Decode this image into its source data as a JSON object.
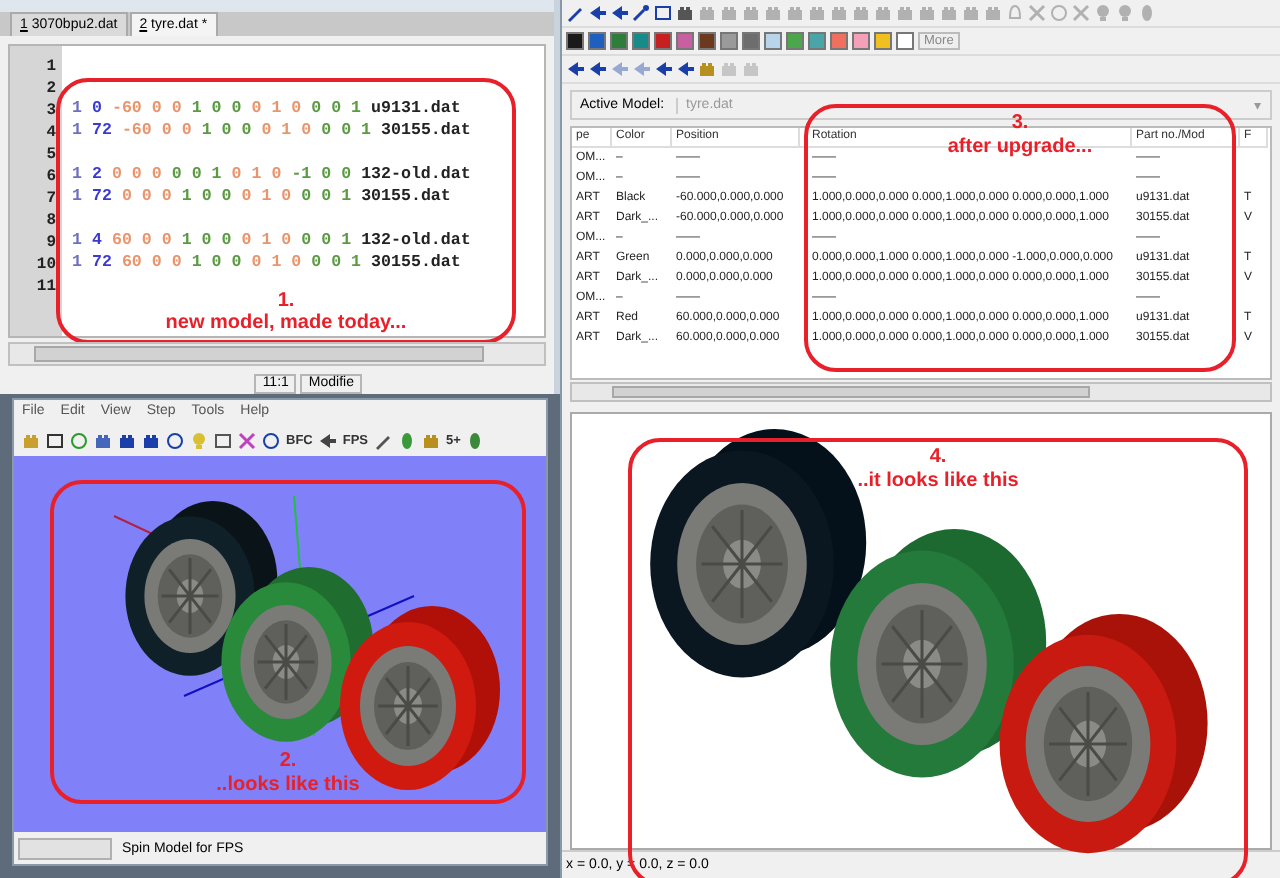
{
  "editor": {
    "tabs": [
      {
        "key": "1",
        "name": "3070bpu2.dat",
        "selected": false
      },
      {
        "key": "2",
        "name": "tyre.dat *",
        "selected": true
      }
    ],
    "lines": [
      {
        "number": "1",
        "kind": "blank"
      },
      {
        "number": "2",
        "kind": "blank"
      },
      {
        "number": "3",
        "kind": "part",
        "type": "1",
        "color_code": "0",
        "position": "-60 0 0",
        "rotation": [
          "1 0 0",
          "0 1 0",
          "0 0 1"
        ],
        "file": "u9131.dat"
      },
      {
        "number": "4",
        "kind": "part",
        "type": "1",
        "color_code": "72",
        "position": "-60 0 0",
        "rotation": [
          "1 0 0",
          "0 1 0",
          "0 0 1"
        ],
        "file": "30155.dat"
      },
      {
        "number": "5",
        "kind": "blank"
      },
      {
        "number": "6",
        "kind": "part",
        "type": "1",
        "color_code": "2",
        "position": "0 0 0",
        "rotation": [
          "0 0 1",
          "0 1 0",
          "-1 0 0"
        ],
        "file": "132-old.dat"
      },
      {
        "number": "7",
        "kind": "part",
        "type": "1",
        "color_code": "72",
        "position": "0 0 0",
        "rotation": [
          "1 0 0",
          "0 1 0",
          "0 0 1"
        ],
        "file": "30155.dat"
      },
      {
        "number": "8",
        "kind": "blank"
      },
      {
        "number": "9",
        "kind": "part",
        "type": "1",
        "color_code": "4",
        "position": "60 0 0",
        "rotation": [
          "1 0 0",
          "0 1 0",
          "0 0 1"
        ],
        "file": "132-old.dat"
      },
      {
        "number": "10",
        "kind": "part",
        "type": "1",
        "color_code": "72",
        "position": "60 0 0",
        "rotation": [
          "1 0 0",
          "0 1 0",
          "0 0 1"
        ],
        "file": "30155.dat"
      },
      {
        "number": "11",
        "kind": "blank"
      }
    ],
    "annotation": {
      "number": "1.",
      "text": "new model, made today..."
    },
    "status": {
      "position": "11:1",
      "state": "Modifie"
    }
  },
  "viewer": {
    "menu": [
      "File",
      "Edit",
      "View",
      "Step",
      "Tools",
      "Help"
    ],
    "toolbar_texts": [
      "BFC",
      "FPS",
      "5+"
    ],
    "annotation": {
      "number": "2.",
      "text": "..looks like this"
    },
    "status": {
      "progress": {
        "level": 0
      },
      "message": "Spin Model for FPS"
    }
  },
  "modeler": {
    "swatches": [
      {
        "color": "#1a1a1a"
      },
      {
        "color": "#1e5fc0"
      },
      {
        "color": "#2e7d3a"
      },
      {
        "color": "#178a8a"
      },
      {
        "color": "#c82020"
      },
      {
        "color": "#c85fa0"
      },
      {
        "color": "#6b3a1e"
      },
      {
        "color": "#9a9a9a"
      },
      {
        "color": "#6d6d6d"
      },
      {
        "color": "#b8d4ea"
      },
      {
        "color": "#4ca64c"
      },
      {
        "color": "#4aa5a8"
      },
      {
        "color": "#f07060"
      },
      {
        "color": "#f4a0b8"
      },
      {
        "color": "#f0c020"
      },
      {
        "color": "#ffffff"
      }
    ],
    "more_button": "More",
    "active_model": {
      "label": "Active Model:",
      "value": "tyre.dat",
      "caret": "▾"
    },
    "table": {
      "columns": [
        "pe",
        "Color",
        "Position",
        "Rotation",
        "Part no./Mod",
        "F"
      ],
      "rows": [
        [
          "OM...",
          "–",
          "——",
          "——",
          "——"
        ],
        [
          "OM...",
          "–",
          "——",
          "——",
          "——"
        ],
        [
          "ART",
          "Black",
          "-60.000,0.000,0.000",
          "1.000,0.000,0.000 0.000,1.000,0.000 0.000,0.000,1.000",
          "u9131.dat",
          "T"
        ],
        [
          "ART",
          "Dark_...",
          "-60.000,0.000,0.000",
          "1.000,0.000,0.000 0.000,1.000,0.000 0.000,0.000,1.000",
          "30155.dat",
          "V"
        ],
        [
          "OM...",
          "–",
          "——",
          "——",
          "——"
        ],
        [
          "ART",
          "Green",
          "0.000,0.000,0.000",
          "0.000,0.000,1.000 0.000,1.000,0.000 -1.000,0.000,0.000",
          "u9131.dat",
          "T"
        ],
        [
          "ART",
          "Dark_...",
          "0.000,0.000,0.000",
          "1.000,0.000,0.000 0.000,1.000,0.000 0.000,0.000,1.000",
          "30155.dat",
          "V"
        ],
        [
          "OM...",
          "–",
          "——",
          "——",
          "——"
        ],
        [
          "ART",
          "Red",
          "60.000,0.000,0.000",
          "1.000,0.000,0.000 0.000,1.000,0.000 0.000,0.000,1.000",
          "u9131.dat",
          "T"
        ],
        [
          "ART",
          "Dark_...",
          "60.000,0.000,0.000",
          "1.000,0.000,0.000 0.000,1.000,0.000 0.000,0.000,1.000",
          "30155.dat",
          "V"
        ]
      ]
    },
    "table_annotation": {
      "number": "3.",
      "text": "after upgrade..."
    },
    "view_annotation": {
      "number": "4.",
      "text": "..it looks like this"
    },
    "status": "x = 0.0, y = 0.0, z = 0.0"
  }
}
